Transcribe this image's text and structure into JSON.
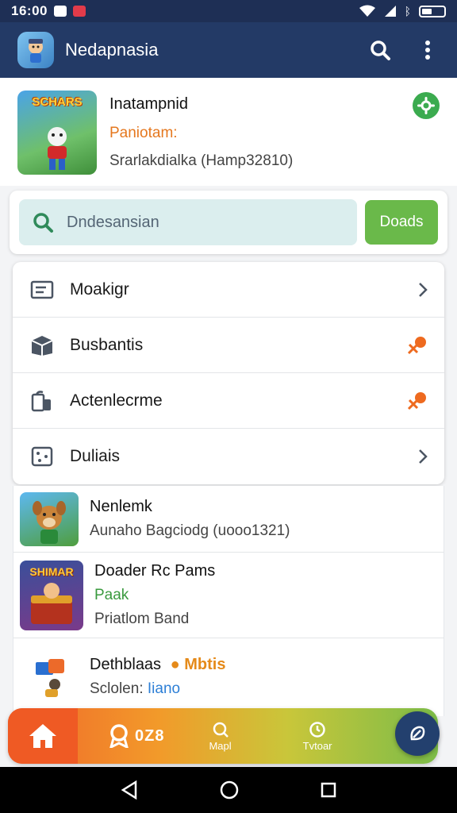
{
  "status_bar": {
    "time": "16:00"
  },
  "app_bar": {
    "title": "Nedapnasia"
  },
  "featured": {
    "logo_text": "SCHARS",
    "title": "Inatampnid",
    "subtitle": "Paniotam:",
    "meta": "Srarlakdialka (Hamp32810)"
  },
  "search": {
    "text": "Dndesansian",
    "button_label": "Doads"
  },
  "menu": {
    "items": [
      {
        "label": "Moakigr",
        "icon": "list-icon",
        "trail": "chevron-right-icon"
      },
      {
        "label": "Busbantis",
        "icon": "box-icon",
        "trail": "pin-icon"
      },
      {
        "label": "Actenlecrme",
        "icon": "device-icon",
        "trail": "pin-icon"
      },
      {
        "label": "Duliais",
        "icon": "dice-icon",
        "trail": "chevron-right-icon"
      }
    ]
  },
  "games": [
    {
      "title": "Nenlemk",
      "line1": "Aunaho Bagciodg (uooo1321)",
      "line2": ""
    },
    {
      "logo_text": "SHIMAR",
      "title": "Doader Rc Pams",
      "line1": "Paak",
      "line2": "Priatlom Band"
    },
    {
      "title": "Dethblaas",
      "title_badge": "Mbtis",
      "line1_label": "Sclolen:",
      "line1_value": "Iiano"
    }
  ],
  "bottom_nav": {
    "score": "0Z8",
    "map_label": "Mapl",
    "timer_label": "Tvtoar"
  },
  "colors": {
    "app_bar": "#233a66",
    "status_bar": "#1e2f55",
    "accent_green": "#6ab94a",
    "accent_orange": "#e5781f",
    "fab": "#23406e"
  }
}
